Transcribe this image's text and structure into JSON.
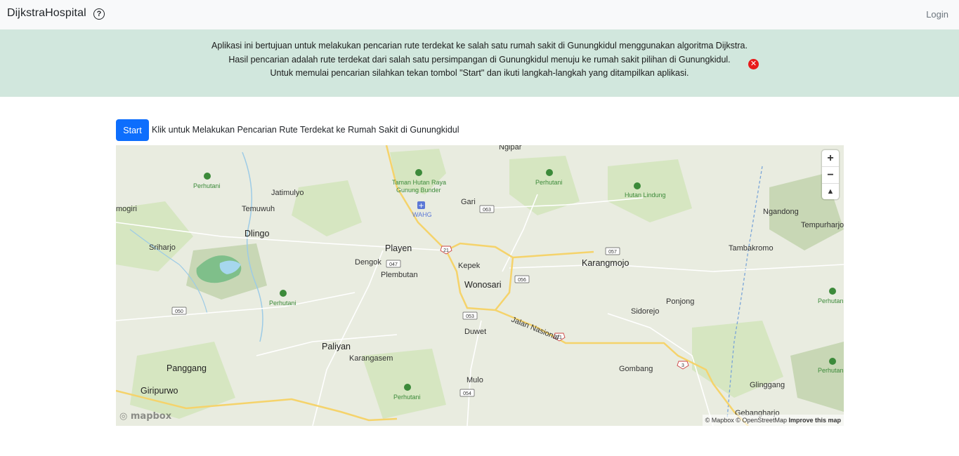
{
  "navbar": {
    "brand": "DijkstraHospital",
    "help_icon": "question-circle-icon",
    "login": "Login"
  },
  "alert": {
    "line1": "Aplikasi ini bertujuan untuk melakukan pencarian rute terdekat ke salah satu rumah sakit di Gunungkidul menggunakan algoritma Dijkstra.",
    "line2": "Hasil pencarian adalah rute terdekat dari salah satu persimpangan di Gunungkidul menuju ke rumah sakit pilihan di Gunungkidul.",
    "line3": "Untuk memulai pencarian silahkan tekan tombol \"Start\" dan ikuti langkah-langkah yang ditampilkan aplikasi.",
    "close_icon": "close-circle-icon",
    "close_symbol": "✕",
    "color": "#d1e7dd"
  },
  "start": {
    "button": "Start",
    "description": "Klik untuk Melakukan Pencarian Rute Terdekat ke Rumah Sakit di Gunungkidul",
    "color": "#0d6efd"
  },
  "map": {
    "zoom_in": "+",
    "zoom_out": "−",
    "compass": "▲",
    "logo": "mapbox",
    "attribution_mapbox": "© Mapbox",
    "attribution_osm": "© OpenStreetMap",
    "improve": "Improve this map",
    "labels": {
      "ngipar": "Ngipar",
      "perhutani_1": "Perhutani",
      "taman_hutan": "Taman Hutan Raya",
      "gunung_bunder": "Gunung Bunder",
      "perhutani_2": "Perhutani",
      "hutan_lindung": "Hutan Lindung",
      "jatimulyo": "Jatimulyo",
      "mogiri": "mogiri",
      "temuwuh": "Temuwuh",
      "wahg": "WAHG",
      "gari": "Gari",
      "ngandong": "Ngandong",
      "tempurharjo": "Tempurharjo",
      "dlingo": "Dlingo",
      "sriharjo": "Sriharjo",
      "playen": "Playen",
      "tambakromo": "Tambakromo",
      "dengok": "Dengok",
      "kepek": "Kepek",
      "karangmojo": "Karangmojo",
      "plembutan": "Plembutan",
      "wonosari": "Wonosari",
      "perhutani_3": "Perhutani",
      "ponjong": "Ponjong",
      "perhutani_4": "Perhutani",
      "sidorejo": "Sidorejo",
      "jalan_nasional": "Jalan Nasional",
      "duwet": "Duwet",
      "paliyan": "Paliyan",
      "karangasem": "Karangasem",
      "panggang": "Panggang",
      "gombang": "Gombang",
      "perhutani_5": "Perhutani",
      "mulo": "Mulo",
      "giripurwo": "Giripurwo",
      "perhutani_6": "Perhutani",
      "glinggang": "Glinggang",
      "gebangharjo": "Gebangharjo"
    },
    "shields": {
      "r063": "063",
      "r057": "057",
      "r21a": "21",
      "r047": "047",
      "r056": "056",
      "r050": "050",
      "r053": "053",
      "r21b": "21",
      "r3": "3",
      "r054": "054"
    },
    "colors": {
      "land": "#e9ece0",
      "forest": "#cfe3b8",
      "water": "#a6d7ee",
      "trunk": "#f5d36b",
      "park": "#3c8a3a"
    }
  }
}
